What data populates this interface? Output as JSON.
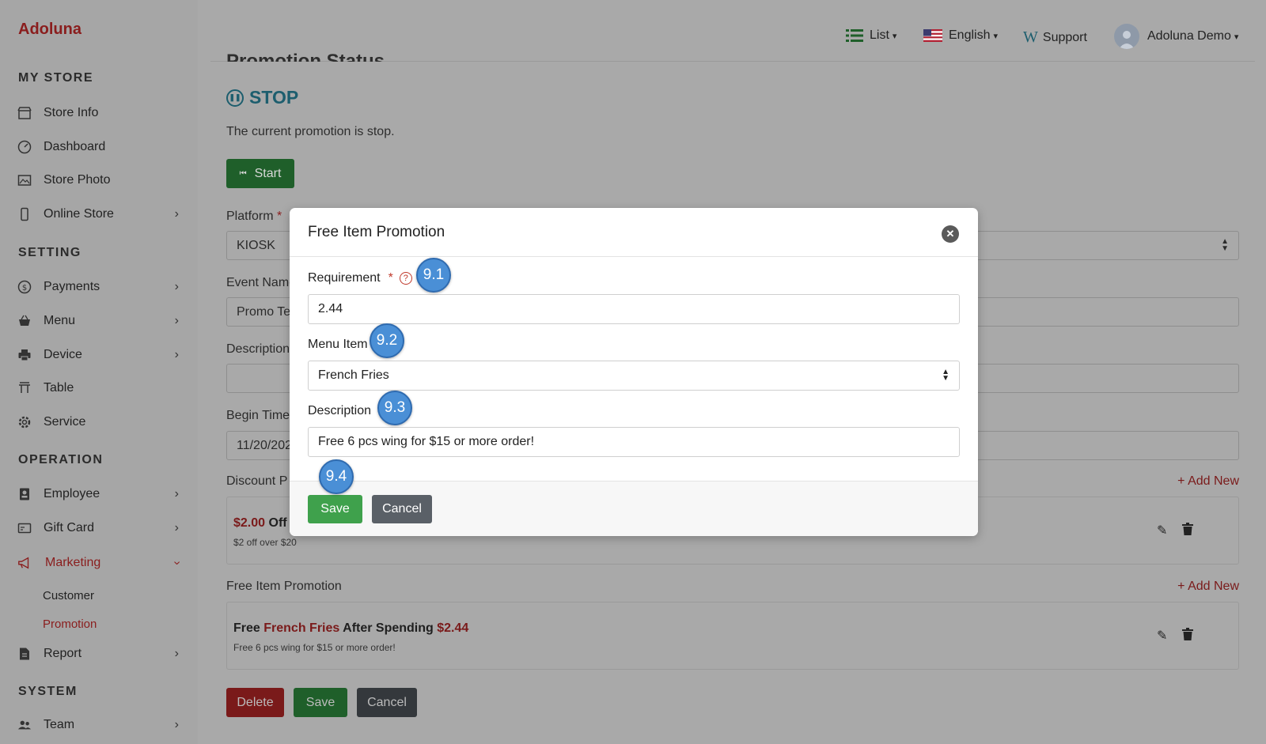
{
  "brand": "Adoluna",
  "sidebar": {
    "sections": [
      {
        "title": "MY STORE",
        "items": [
          {
            "label": "Store Info",
            "icon": "store-icon"
          },
          {
            "label": "Dashboard",
            "icon": "dashboard-icon"
          },
          {
            "label": "Store Photo",
            "icon": "photo-icon"
          },
          {
            "label": "Online Store",
            "icon": "mobile-icon",
            "has_children": true
          }
        ]
      },
      {
        "title": "SETTING",
        "items": [
          {
            "label": "Payments",
            "icon": "dollar-icon",
            "has_children": true
          },
          {
            "label": "Menu",
            "icon": "basket-icon",
            "has_children": true
          },
          {
            "label": "Device",
            "icon": "printer-icon",
            "has_children": true
          },
          {
            "label": "Table",
            "icon": "table-icon"
          },
          {
            "label": "Service",
            "icon": "gear-icon"
          }
        ]
      },
      {
        "title": "OPERATION",
        "items": [
          {
            "label": "Employee",
            "icon": "badge-icon",
            "has_children": true
          },
          {
            "label": "Gift Card",
            "icon": "card-icon",
            "has_children": true
          },
          {
            "label": "Marketing",
            "icon": "megaphone-icon",
            "expanded": true
          },
          {
            "label": "Report",
            "icon": "report-icon",
            "has_children": true
          }
        ]
      },
      {
        "title": "SYSTEM",
        "items": [
          {
            "label": "Team",
            "icon": "team-icon",
            "has_children": true
          }
        ]
      }
    ],
    "marketing_sub": [
      "Customer",
      "Promotion"
    ],
    "active_sub": "Promotion"
  },
  "topbar": {
    "view": "List",
    "language": "English",
    "support": "Support",
    "user": "Adoluna Demo"
  },
  "page": {
    "section_title": "Promotion Status",
    "status": "STOP",
    "status_text": "The current promotion is stop.",
    "start_label": "Start",
    "platform_label": "Platform",
    "platform_value": "KIOSK",
    "event_name_label": "Event Name",
    "event_name_value": "Promo Te",
    "description_label": "Description",
    "begin_time_label": "Begin Time",
    "begin_time_value": "11/20/202",
    "discount_label": "Discount P",
    "add_new": "+ Add New",
    "discount_card": {
      "amount": "$2.00",
      "suffix": " Off",
      "sub": "$2 off over $20"
    },
    "free_item_label": "Free Item Promotion",
    "free_card": {
      "p1": "Free ",
      "item": "French Fries",
      "p2": " After Spending ",
      "amount": "$2.44",
      "sub": "Free 6 pcs wing for $15 or more order!"
    },
    "delete_label": "Delete",
    "save_label": "Save",
    "cancel_label": "Cancel"
  },
  "modal": {
    "title": "Free Item Promotion",
    "requirement_label": "Requirement",
    "requirement_value": "2.44",
    "menu_item_label": "Menu Item",
    "menu_item_value": "French Fries",
    "description_label": "Description",
    "description_value": "Free 6 pcs wing for $15 or more order!",
    "save_label": "Save",
    "cancel_label": "Cancel"
  },
  "badges": [
    "9.1",
    "9.2",
    "9.3",
    "9.4"
  ]
}
